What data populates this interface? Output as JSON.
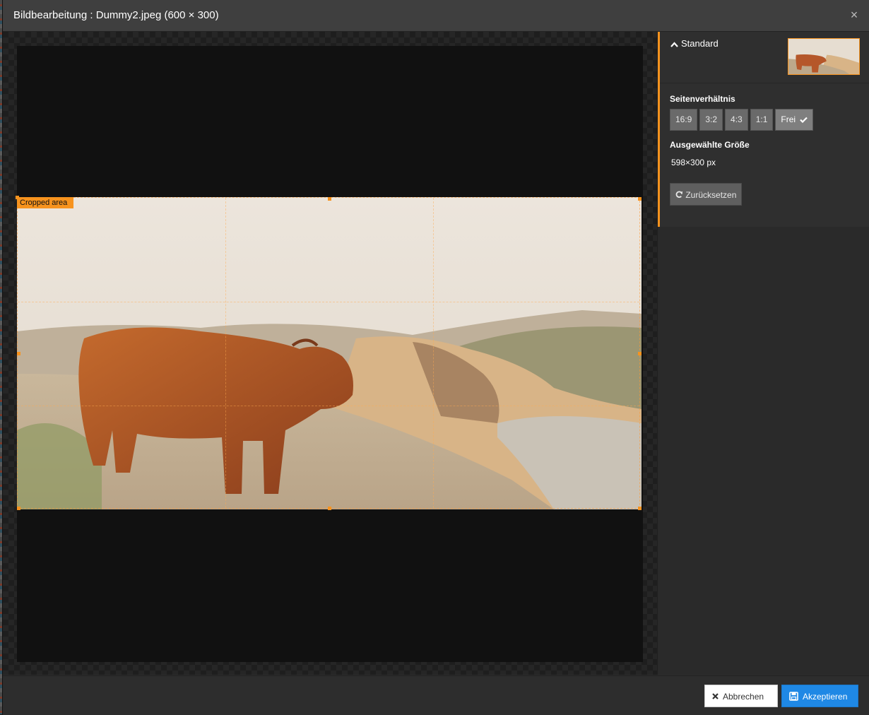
{
  "header": {
    "title": "Bildbearbeitung : Dummy2.jpeg (600 × 300)",
    "close_symbol": "×"
  },
  "stage": {
    "crop_label": "Cropped area"
  },
  "sidebar": {
    "variant_title": "Standard",
    "aspect_label": "Seitenverhältnis",
    "ratios": [
      {
        "label": "16:9",
        "active": false
      },
      {
        "label": "3:2",
        "active": false
      },
      {
        "label": "4:3",
        "active": false
      },
      {
        "label": "1:1",
        "active": false
      },
      {
        "label": "Frei",
        "active": true
      }
    ],
    "size_label": "Ausgewählte Größe",
    "size_value": "598×300 px",
    "reset_label": "Zurücksetzen"
  },
  "footer": {
    "cancel_label": "Abbrechen",
    "accept_label": "Akzeptieren"
  },
  "colors": {
    "accent": "#f7931e",
    "primary": "#1f88e5"
  },
  "icons": {
    "close": "close-icon",
    "chevron": "chevron-up-icon",
    "check": "check-icon",
    "refresh": "refresh-icon",
    "cancel": "cancel-x-icon",
    "save": "save-icon"
  }
}
